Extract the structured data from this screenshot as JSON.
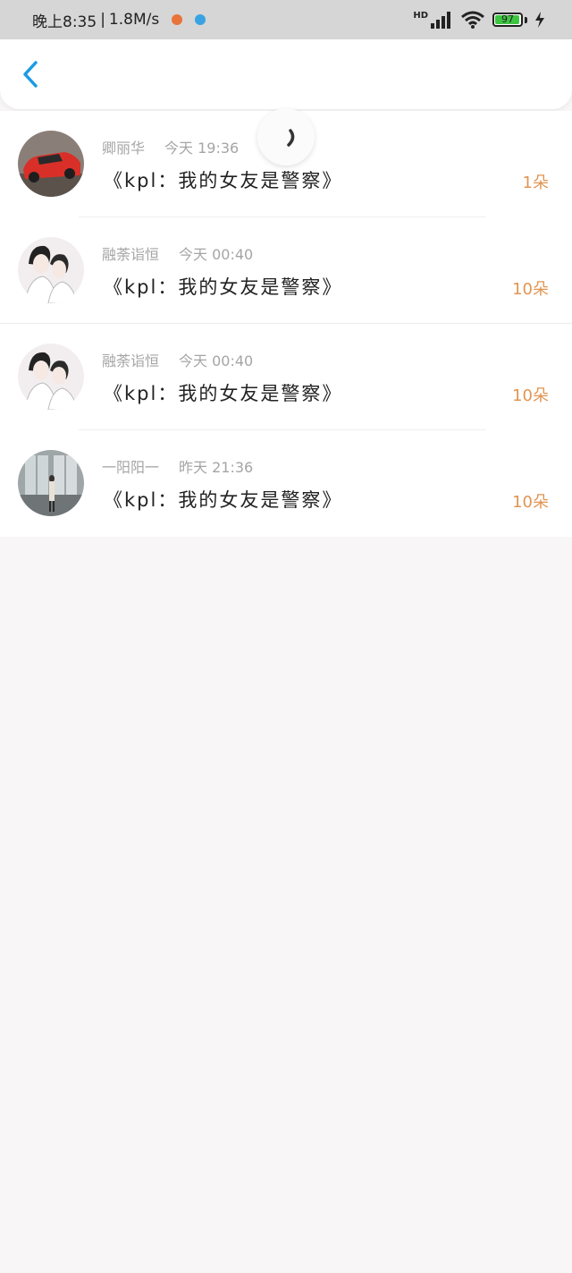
{
  "status_bar": {
    "time": "晚上8:35",
    "net_speed": "1.8M/s",
    "network_label": "HD",
    "battery": "97",
    "battery_level": 0.97
  },
  "header": {
    "back_icon": "chevron-left-icon"
  },
  "colors": {
    "accent_blue": "#1a9be6",
    "amount_orange": "#e19552",
    "meta_gray": "#a5a5a5"
  },
  "gifts": [
    {
      "name": "卿丽华",
      "time": "今天 19:36",
      "message": "《kpl：我的女友是警察》",
      "amount": "1朵"
    },
    {
      "name": "融荼诣恒",
      "time": "今天 00:40",
      "message": "《kpl：我的女友是警察》",
      "amount": "10朵"
    },
    {
      "name": "融荼诣恒",
      "time": "今天 00:40",
      "message": "《kpl：我的女友是警察》",
      "amount": "10朵"
    },
    {
      "name": "一阳阳一",
      "time": "昨天 21:36",
      "message": "《kpl：我的女友是警察》",
      "amount": "10朵"
    }
  ]
}
